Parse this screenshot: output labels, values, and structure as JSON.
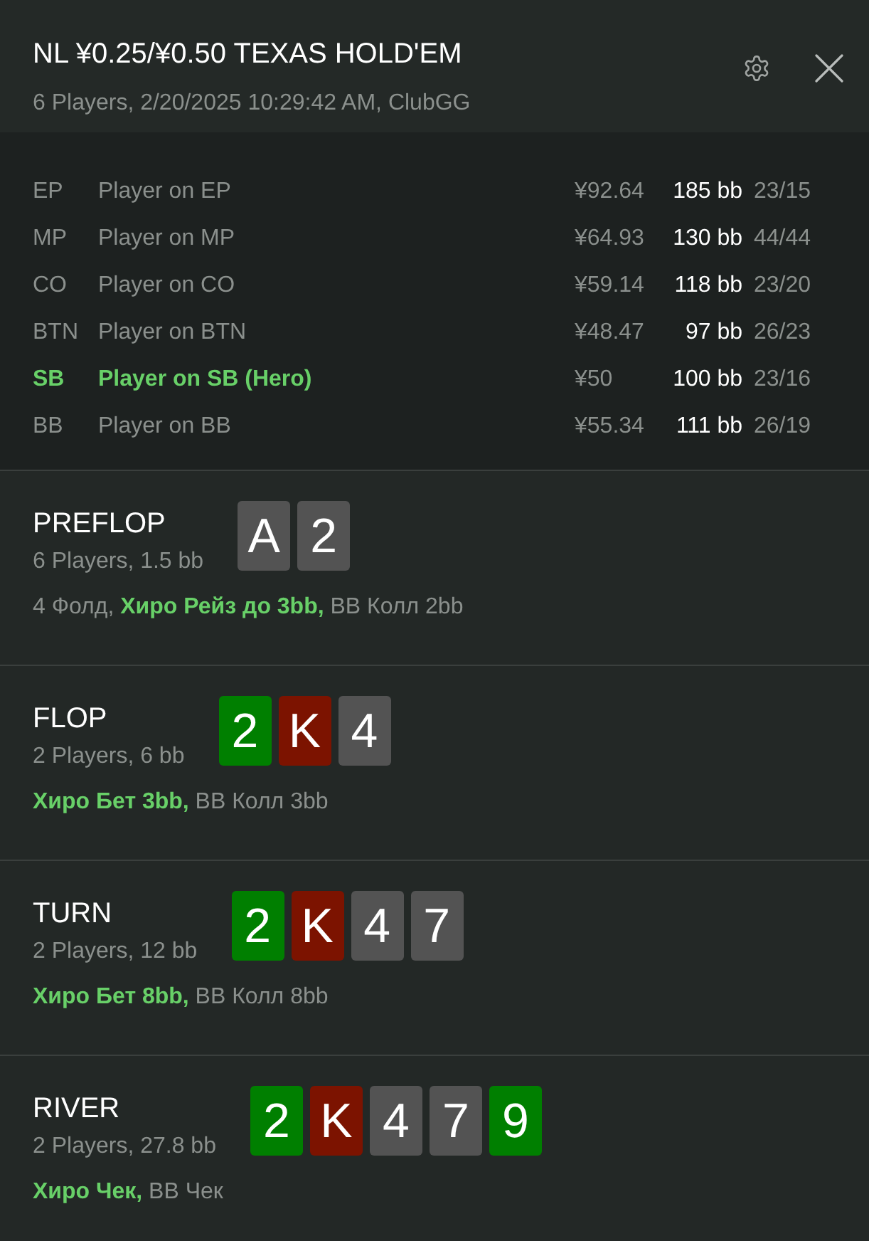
{
  "window": {
    "title": "NL ¥0.25/¥0.50 TEXAS HOLD'EM",
    "subtitle": "6 Players, 2/20/2025 10:29:42 AM, ClubGG"
  },
  "players": [
    {
      "position": "EP",
      "name": "Player on EP",
      "stack": "¥92.64",
      "stack_bb": "185 bb",
      "stats": "23/15",
      "hero": false
    },
    {
      "position": "MP",
      "name": "Player on MP",
      "stack": "¥64.93",
      "stack_bb": "130 bb",
      "stats": "44/44",
      "hero": false
    },
    {
      "position": "CO",
      "name": "Player on CO",
      "stack": "¥59.14",
      "stack_bb": "118 bb",
      "stats": "23/20",
      "hero": false
    },
    {
      "position": "BTN",
      "name": "Player on BTN",
      "stack": "¥48.47",
      "stack_bb": "97 bb",
      "stats": "26/23",
      "hero": false
    },
    {
      "position": "SB",
      "name": "Player on SB (Hero)",
      "stack": "¥50",
      "stack_bb": "100 bb",
      "stats": "23/16",
      "hero": true
    },
    {
      "position": "BB",
      "name": "Player on BB",
      "stack": "¥55.34",
      "stack_bb": "111 bb",
      "stats": "26/19",
      "hero": false
    }
  ],
  "streets": [
    {
      "name": "PREFLOP",
      "info": "6 Players, 1.5 bb",
      "cards": [
        {
          "rank": "A",
          "color": "#535353"
        },
        {
          "rank": "2",
          "color": "#535353"
        }
      ],
      "actions": "4 Фолд, **Хиро Рейз до 3bb,** BB Колл 2bb"
    },
    {
      "name": "FLOP",
      "info": "2 Players, 6 bb",
      "cards": [
        {
          "rank": "2",
          "color": "#007f00"
        },
        {
          "rank": "K",
          "color": "#7c1300"
        },
        {
          "rank": "4",
          "color": "#535353"
        }
      ],
      "actions": "**Хиро Бет 3bb,** BB Колл 3bb"
    },
    {
      "name": "TURN",
      "info": "2 Players, 12 bb",
      "cards": [
        {
          "rank": "2",
          "color": "#007f00"
        },
        {
          "rank": "K",
          "color": "#7c1300"
        },
        {
          "rank": "4",
          "color": "#535353"
        },
        {
          "rank": "7",
          "color": "#535353"
        }
      ],
      "actions": "**Хиро Бет 8bb,** BB Колл 8bb"
    },
    {
      "name": "RIVER",
      "info": "2 Players, 27.8 bb",
      "cards": [
        {
          "rank": "2",
          "color": "#007f00"
        },
        {
          "rank": "K",
          "color": "#7c1300"
        },
        {
          "rank": "4",
          "color": "#535353"
        },
        {
          "rank": "7",
          "color": "#535353"
        },
        {
          "rank": "9",
          "color": "#007f00"
        }
      ],
      "actions": "**Хиро Чек,** BB Чек"
    }
  ]
}
